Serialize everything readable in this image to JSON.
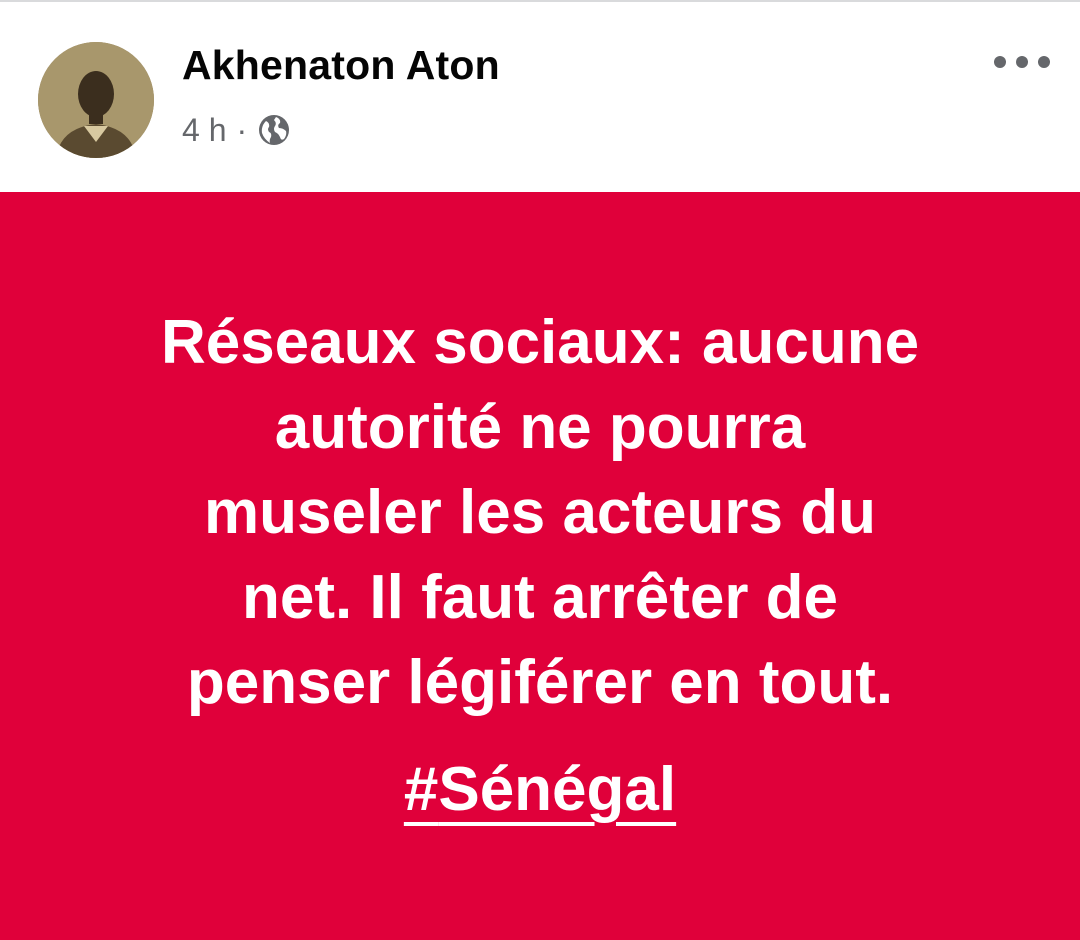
{
  "post": {
    "author": {
      "name": "Akhenaton Aton",
      "avatar_icon": "profile-photo"
    },
    "meta": {
      "time": "4 h",
      "separator": "·",
      "privacy_icon": "globe-icon"
    },
    "more_icon": "more-dots-icon",
    "content": {
      "background_color": "#e0003a",
      "text_color": "#ffffff",
      "text": "Réseaux sociaux: aucune\nautorité ne pourra\nmuseler les acteurs du\nnet. Il faut arrêter de\npenser légiférer en tout.",
      "hashtag_prefix": "#",
      "hashtag_word": "Sénégal"
    }
  }
}
